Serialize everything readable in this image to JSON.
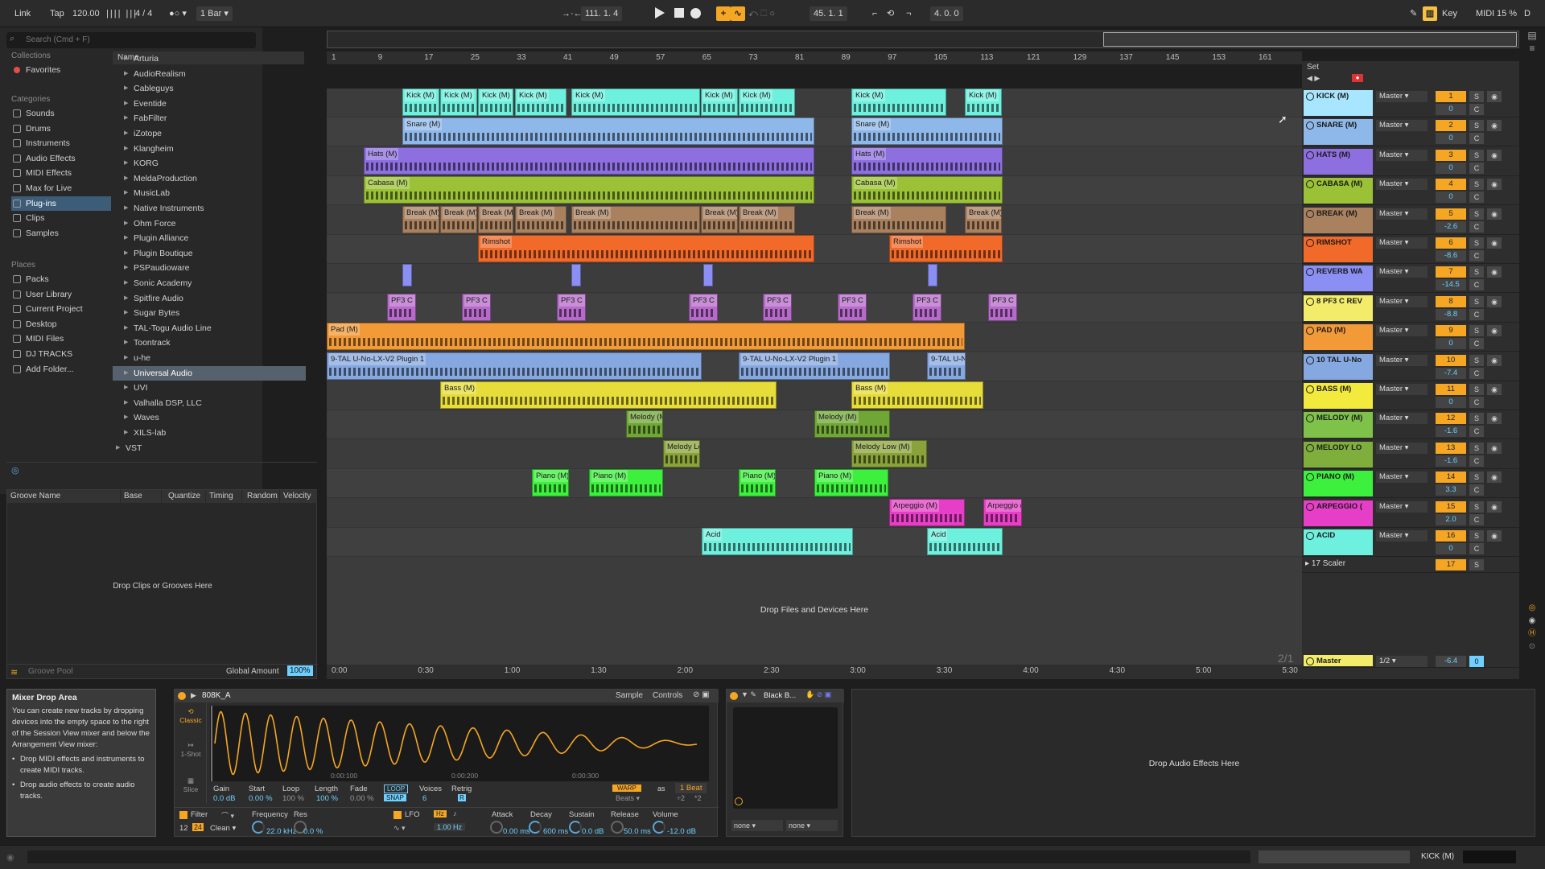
{
  "transport": {
    "link": "Link",
    "tap": "Tap",
    "tempo": "120.00",
    "sig": "4 / 4",
    "quant": "1 Bar",
    "position": "111.  1.  4",
    "loop_start": "45.  1.  1",
    "loop_length": "4.  0.  0",
    "key": "Key",
    "midi": "MIDI",
    "cpu": "15 %",
    "d": "D"
  },
  "browser": {
    "search_placeholder": "Search (Cmd + F)",
    "collections_title": "Collections",
    "favorites": "Favorites",
    "categories_title": "Categories",
    "categories": [
      "Sounds",
      "Drums",
      "Instruments",
      "Audio Effects",
      "MIDI Effects",
      "Max for Live",
      "Plug-ins",
      "Clips",
      "Samples"
    ],
    "places_title": "Places",
    "places": [
      "Packs",
      "User Library",
      "Current Project",
      "Desktop",
      "MIDI Files",
      "DJ TRACKS",
      "Add Folder..."
    ],
    "name_header": "Name",
    "names": [
      "Arturia",
      "AudioRealism",
      "Cableguys",
      "Eventide",
      "FabFilter",
      "iZotope",
      "Klangheim",
      "KORG",
      "MeldaProduction",
      "MusicLab",
      "Native Instruments",
      "Ohm Force",
      "Plugin Alliance",
      "Plugin Boutique",
      "PSPaudioware",
      "Sonic Academy",
      "Spitfire Audio",
      "Sugar Bytes",
      "TAL-Togu Audio Line",
      "Toontrack",
      "u-he",
      "Universal Audio",
      "UVI",
      "Valhalla DSP, LLC",
      "Waves",
      "XILS-lab",
      "VST"
    ]
  },
  "groove": {
    "headers": [
      "Groove Name",
      "Base",
      "Quantize",
      "Timing",
      "Random",
      "Velocity"
    ],
    "drop": "Drop Clips or Grooves Here",
    "pool": "Groove Pool",
    "global_label": "Global Amount",
    "global_value": "100%"
  },
  "ruler": [
    "1",
    "9",
    "17",
    "25",
    "33",
    "41",
    "49",
    "57",
    "65",
    "73",
    "81",
    "89",
    "97",
    "105",
    "113",
    "121",
    "129",
    "137",
    "145",
    "153",
    "161"
  ],
  "timeline": [
    "0:00",
    "0:30",
    "1:00",
    "1:30",
    "2:00",
    "2:30",
    "3:00",
    "3:30",
    "4:00",
    "4:30",
    "5:00",
    "5:30"
  ],
  "drop_files": "Drop Files and Devices Here",
  "clips": {
    "kick": [
      "Kick (M)",
      "Kick (M)",
      "Kick (M)",
      "Kick (M)",
      "Kick (M)",
      "Kick (M)",
      "Kick (M)",
      "Kick (M)",
      "Kick (M)"
    ],
    "snare": [
      "Snare (M)",
      "Snare (M)"
    ],
    "hats": [
      "Hats (M)",
      "Hats (M)"
    ],
    "cabasa": [
      "Cabasa (M)",
      "Cabasa (M)"
    ],
    "break": [
      "Break (M)",
      "Break (M)",
      "Break (M)",
      "Break (M)",
      "Break (M)",
      "Break (M)",
      "Break (M)",
      "Break (M)",
      "Break (M)"
    ],
    "rimshot": [
      "Rimshot",
      "Rimshot"
    ],
    "pf3": [
      "PF3 C RE",
      "PF3 C RE",
      "PF3 C RE",
      "PF3 C RE",
      "PF3 C RE",
      "PF3 C RE",
      "PF3 C RE",
      "PF3 C RE"
    ],
    "pad": [
      "Pad (M)"
    ],
    "tal": [
      "9-TAL U-No-LX-V2 Plugin 1",
      "9-TAL U-No-LX-V2 Plugin 1",
      "9-TAL U-No-"
    ],
    "bass": [
      "Bass (M)",
      "Bass (M)"
    ],
    "melody": [
      "Melody (M)",
      "Melody (M)"
    ],
    "melodylow": [
      "Melody Low",
      "Melody Low (M)"
    ],
    "piano": [
      "Piano (M)",
      "Piano (M)",
      "Piano (M)",
      "Piano (M)"
    ],
    "arp": [
      "Arpeggio (M)",
      "Arpeggio (M"
    ],
    "acid": [
      "Acid",
      "Acid"
    ]
  },
  "mixer": {
    "set_label": "Set",
    "tracks": [
      {
        "name": "KICK (M)",
        "out": "Master",
        "num": "1",
        "vol": "0",
        "color": "#a8e6ff"
      },
      {
        "name": "SNARE (M)",
        "out": "Master",
        "num": "2",
        "vol": "0",
        "color": "#8fb8ea"
      },
      {
        "name": "HATS (M)",
        "out": "Master",
        "num": "3",
        "vol": "0",
        "color": "#8d6fe0"
      },
      {
        "name": "CABASA (M)",
        "out": "Master",
        "num": "4",
        "vol": "0",
        "color": "#9bc236"
      },
      {
        "name": "BREAK (M)",
        "out": "Master",
        "num": "5",
        "vol": "-2.6",
        "color": "#a9815f"
      },
      {
        "name": "RIMSHOT",
        "out": "Master",
        "num": "6",
        "vol": "-8.6",
        "color": "#f26a2a"
      },
      {
        "name": "REVERB WA",
        "out": "Master",
        "num": "7",
        "vol": "-14.5",
        "color": "#8b8ef2"
      },
      {
        "name": "8 PF3 C REV",
        "out": "Master",
        "num": "8",
        "vol": "-8.8",
        "color": "#f2ec6a"
      },
      {
        "name": "PAD (M)",
        "out": "Master",
        "num": "9",
        "vol": "0",
        "color": "#f29a38"
      },
      {
        "name": "10 TAL U-No",
        "out": "Master",
        "num": "10",
        "vol": "-7.4",
        "color": "#86a8e0"
      },
      {
        "name": "BASS (M)",
        "out": "Master",
        "num": "11",
        "vol": "0",
        "color": "#f2ea3c"
      },
      {
        "name": "MELODY (M)",
        "out": "Master",
        "num": "12",
        "vol": "-1.6",
        "color": "#7ec24a"
      },
      {
        "name": "MELODY LO",
        "out": "Master",
        "num": "13",
        "vol": "-1.6",
        "color": "#7fae3c"
      },
      {
        "name": "PIANO (M)",
        "out": "Master",
        "num": "14",
        "vol": "3.3",
        "color": "#3df03d"
      },
      {
        "name": "ARPEGGIO (",
        "out": "Master",
        "num": "15",
        "vol": "2.0",
        "color": "#e63ec6"
      },
      {
        "name": "ACID",
        "out": "Master",
        "num": "16",
        "vol": "0",
        "color": "#6ef0de"
      }
    ],
    "scaler": {
      "name": "17 Scaler",
      "num": "17"
    },
    "master": {
      "name": "Master",
      "out": "1/2",
      "vol": "-6.4",
      "num": "0"
    },
    "s": "S",
    "c": "C"
  },
  "info": {
    "title": "Mixer Drop Area",
    "body": "You can create new tracks by dropping devices into the empty space to the right of the Session View mixer and below the Arrangement View mixer:",
    "b1": "Drop MIDI effects and instruments to create MIDI tracks.",
    "b2": "Drop audio effects to create audio tracks."
  },
  "sampler": {
    "name": "808K_A",
    "tab1": "Sample",
    "tab2": "Controls",
    "mode_classic": "Classic",
    "mode_oneshot": "1-Shot",
    "mode_slice": "Slice",
    "t1": "0:00:100",
    "t2": "0:00:200",
    "t3": "0:00:300",
    "warp": "WARP",
    "as": "as",
    "beat": "1 Beat",
    "beats": "Beats",
    "half": "÷2",
    "dbl": "*2",
    "params": {
      "gain": "Gain",
      "start": "Start",
      "loop": "Loop",
      "length": "Length",
      "fade": "Fade",
      "loopbtn": "LOOP",
      "voices": "Voices",
      "retrig": "Retrig"
    },
    "values": {
      "gain": "0.0 dB",
      "start": "0.00 %",
      "loop": "100 %",
      "length": "100 %",
      "fade": "0.00 %",
      "snap": "SNAP",
      "voices": "6",
      "retrig": "R"
    },
    "filter": "Filter",
    "f12": "12",
    "f24": "24",
    "clean": "Clean",
    "freq": "Frequency",
    "res": "Res",
    "freq_v": "22.0 kHz",
    "res_v": "0.0 %",
    "lfo": "LFO",
    "hz": "Hz",
    "lfo_v": "1.00 Hz",
    "attack": "Attack",
    "decay": "Decay",
    "sustain": "Sustain",
    "release": "Release",
    "volume": "Volume",
    "attack_v": "0.00 ms",
    "decay_v": "600 ms",
    "sustain_v": "0.0 dB",
    "release_v": "50.0 ms",
    "volume_v": "-12.0 dB"
  },
  "blackbox": {
    "name": "Black B...",
    "none1": "none",
    "none2": "none"
  },
  "fxdrop": "Drop Audio Effects Here",
  "status": {
    "track": "KICK (M)"
  },
  "ratio": "2/1"
}
